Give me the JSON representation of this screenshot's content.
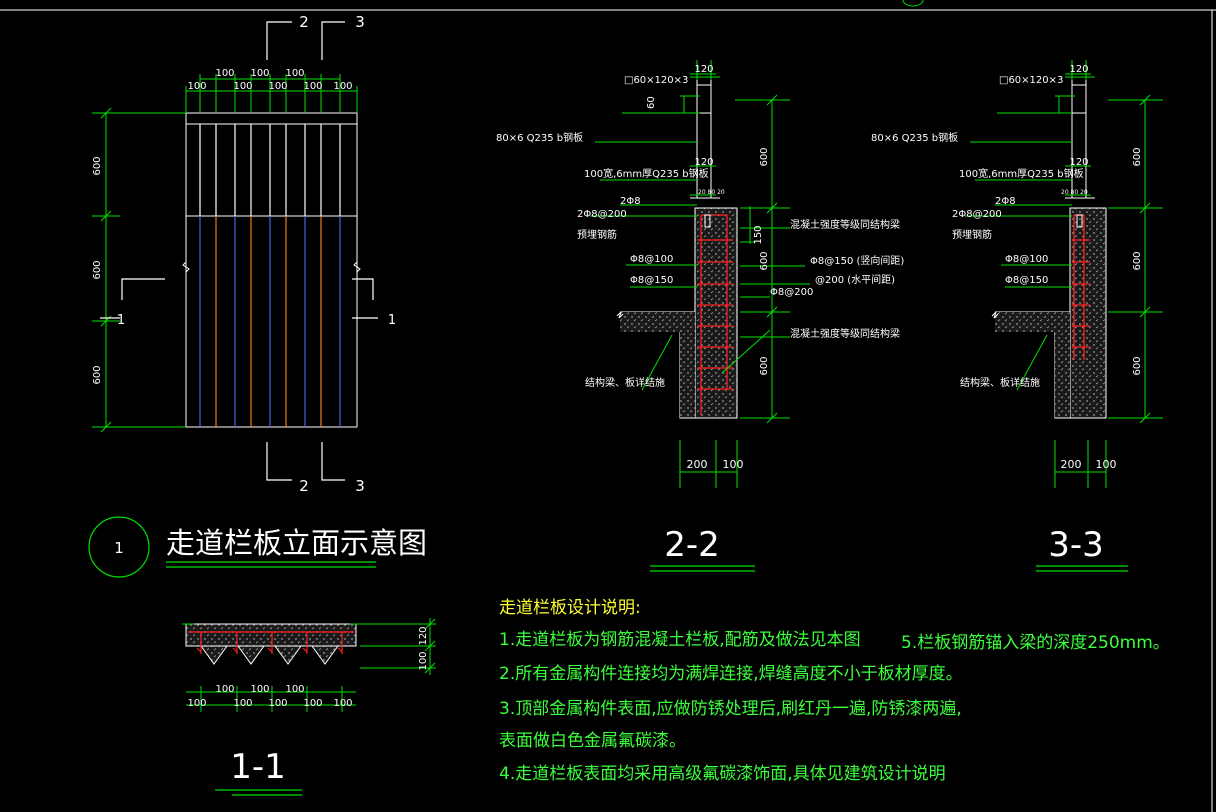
{
  "colors": {
    "background": "#000000",
    "line_white": "#ffffff",
    "line_green": "#00e000",
    "text_green": "#3cff3c",
    "rebar_red": "#ff2020",
    "hatch_gray": "#8a8a8a",
    "slat_orange": "#ff8a1e",
    "slat_blue": "#4a6cff",
    "text_yellow": "#ffff33"
  },
  "elevation": {
    "title": "走道栏板立面示意图",
    "number": "1",
    "section_mark_left": "1",
    "section_mark_right": "1",
    "section_marks_top": [
      "2",
      "3"
    ],
    "section_marks_bottom": [
      "2",
      "3"
    ],
    "top_dims_upper": [
      "100",
      "100",
      "100"
    ],
    "top_dims_lower": [
      "100",
      "100",
      "100",
      "100",
      "100"
    ],
    "left_dims": [
      "600",
      "600",
      "600"
    ]
  },
  "section_1_1": {
    "title": "1-1",
    "right_dims": [
      "120",
      "100"
    ],
    "bottom_dims_upper": [
      "100",
      "100",
      "100"
    ],
    "bottom_dims_lower": [
      "100",
      "100",
      "100",
      "100",
      "100"
    ]
  },
  "section_2_2": {
    "title": "2-2",
    "top_dim": "120",
    "labels": {
      "tube": "□60×120×3",
      "tube_dim": "60",
      "plate_80": "80×6 Q235 b钢板",
      "plate_100": "100宽,6mm厚Q235 b钢板",
      "plate_dim": "120",
      "small_dims": "20  80  20",
      "bar_2": "2Φ8",
      "bar_2_200": "2Φ8@200",
      "embed": "预埋钢筋",
      "concrete_a": "混凝土强度等级同结构梁",
      "dim_150": "150",
      "bar_100": "Φ8@100",
      "bar_150": "Φ8@150",
      "bar_150_v": "Φ8@150 (竖向间距)",
      "bar_200_h": "@200 (水平间距)",
      "bar_200": "Φ8@200",
      "concrete_b": "混凝土强度等级同结构梁",
      "structure": "结构梁、板详结施"
    },
    "right_dims": [
      "600",
      "600",
      "600"
    ],
    "bottom_dims": [
      "200",
      "100"
    ]
  },
  "section_3_3": {
    "title": "3-3",
    "top_dim": "120",
    "labels": {
      "tube": "□60×120×3",
      "plate_80": "80×6 Q235 b钢板",
      "plate_100": "100宽,6mm厚Q235 b钢板",
      "plate_dim": "120",
      "small_dims": "20  80  20",
      "bar_2": "2Φ8",
      "bar_2_200": "2Φ8@200",
      "embed": "预埋钢筋",
      "bar_100": "Φ8@100",
      "bar_150": "Φ8@150",
      "structure": "结构梁、板详结施"
    },
    "right_dims": [
      "600",
      "600",
      "600"
    ],
    "bottom_dims": [
      "200",
      "100"
    ]
  },
  "notes": {
    "heading": "走道栏板设计说明:",
    "items": [
      "1.走道栏板为钢筋混凝土栏板,配筋及做法见本图",
      "2.所有金属构件连接均为满焊连接,焊缝高度不小于板材厚度。",
      "3.顶部金属构件表面,应做防锈处理后,刷红丹一遍,防锈漆两遍,",
      "表面做白色金属氟碳漆。",
      "4.走道栏板表面均采用高级氟碳漆饰面,具体见建筑设计说明"
    ],
    "item5": "5.栏板钢筋锚入梁的深度250mm。"
  }
}
